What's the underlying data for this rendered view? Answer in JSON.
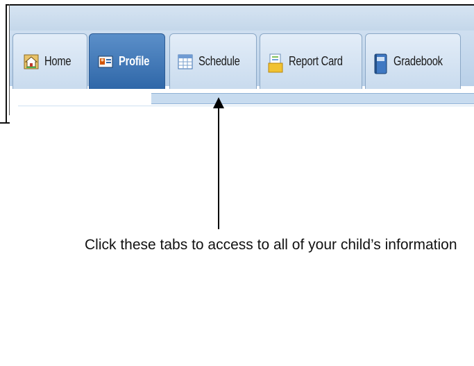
{
  "tabs": [
    {
      "label": "Home",
      "icon": "house-icon",
      "active": false
    },
    {
      "label": "Profile",
      "icon": "id-card-icon",
      "active": true
    },
    {
      "label": "Schedule",
      "icon": "calendar-grid-icon",
      "active": false
    },
    {
      "label": "Report Card",
      "icon": "report-document-icon",
      "active": false
    },
    {
      "label": "Gradebook",
      "icon": "gradebook-binder-icon",
      "active": false
    }
  ],
  "caption": "Click these tabs to access to all of your child’s information",
  "colors": {
    "tab_bg": "#c9dbee",
    "tab_active_bg": "#2f67a8",
    "tabbar_bg": "#b9d0e8"
  }
}
